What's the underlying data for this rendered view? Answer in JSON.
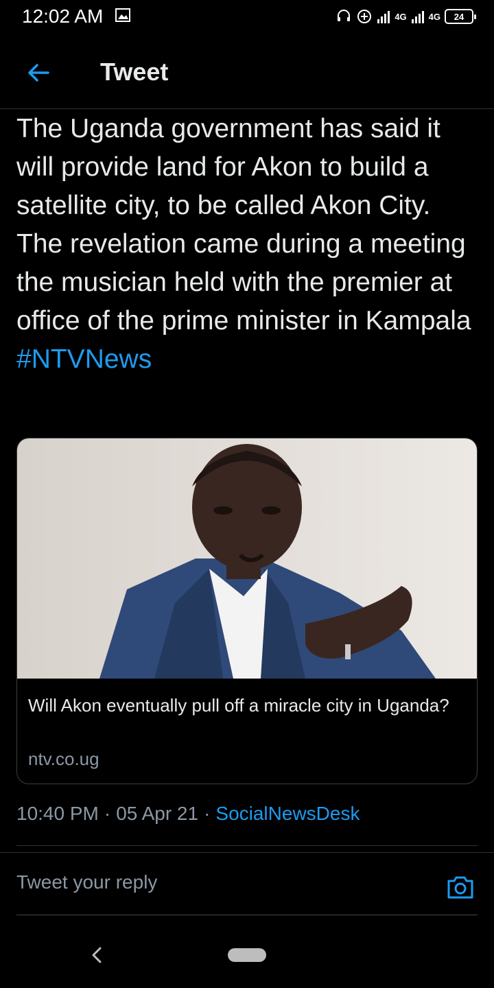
{
  "status": {
    "time": "12:02 AM",
    "net1": "4G",
    "net2": "4G",
    "battery": "24"
  },
  "header": {
    "title": "Tweet"
  },
  "tweet": {
    "text": "The Uganda government has said it will provide land for Akon to build a satellite city, to be called Akon City. The revelation came during a meeting the musician held with the premier at office of the prime minister in Kampala",
    "hashtag": "#NTVNews"
  },
  "card": {
    "title": "Will Akon eventually pull off a miracle city in Uganda?",
    "domain": "ntv.co.ug"
  },
  "meta": {
    "time": "10:40 PM",
    "sep1": "·",
    "date": "05 Apr 21",
    "sep2": "·",
    "source": "SocialNewsDesk"
  },
  "reply": {
    "placeholder": "Tweet your reply"
  },
  "colors": {
    "accent": "#1d9bf0",
    "background": "#000000",
    "muted": "#8b98a5"
  },
  "icons": [
    "back-arrow-icon",
    "camera-icon",
    "nav-back-icon"
  ]
}
